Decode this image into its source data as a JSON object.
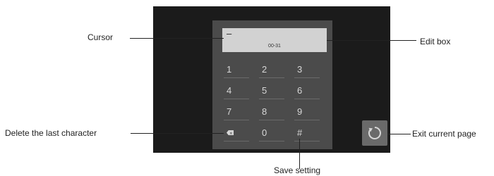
{
  "edit_box": {
    "cursor": "–",
    "value": "00-31"
  },
  "keypad": {
    "keys": [
      "1",
      "2",
      "3",
      "4",
      "5",
      "6",
      "7",
      "8",
      "9",
      "",
      "0",
      "#"
    ]
  },
  "callouts": {
    "cursor": "Cursor",
    "edit_box": "Edit box",
    "delete": "Delete the last character",
    "exit": "Exit current page",
    "save": "Save setting"
  },
  "icons": {
    "backspace": "backspace-icon",
    "exit": "refresh-icon"
  },
  "colors": {
    "screen_bg": "#1b1b1b",
    "panel_bg": "#4b4b4b",
    "edit_box_bg": "#d2d2d2",
    "key_text": "#d7d7d7",
    "exit_button_bg": "#6a6a6a"
  }
}
